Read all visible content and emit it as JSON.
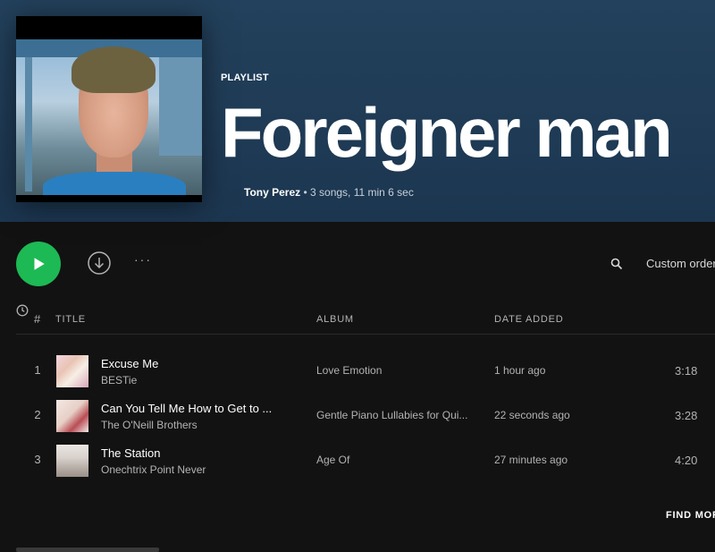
{
  "playlist": {
    "type_label": "PLAYLIST",
    "title": "Foreigner man",
    "owner": "Tony Perez",
    "summary": " • 3 songs, 11 min 6 sec"
  },
  "actions": {
    "more_label": "···",
    "sort_label": "Custom order"
  },
  "table": {
    "headers": {
      "num": "#",
      "title": "TITLE",
      "album": "ALBUM",
      "date_added": "DATE ADDED"
    },
    "rows": [
      {
        "num": "1",
        "title": "Excuse Me",
        "artist": "BESTie",
        "album": "Love Emotion",
        "date_added": "1 hour ago",
        "duration": "3:18"
      },
      {
        "num": "2",
        "title": "Can You Tell Me How to Get to ...",
        "artist": "The O'Neill Brothers",
        "album": "Gentle Piano Lullabies for Qui...",
        "date_added": "22 seconds ago",
        "duration": "3:28"
      },
      {
        "num": "3",
        "title": "The Station",
        "artist": "Onechtrix Point Never",
        "album": "Age Of",
        "date_added": "27 minutes ago",
        "duration": "4:20"
      }
    ]
  },
  "footer": {
    "find_more": "FIND MORE"
  },
  "colors": {
    "accent": "#1db954",
    "hero_bg": "#23415c",
    "page_bg": "#121212"
  }
}
